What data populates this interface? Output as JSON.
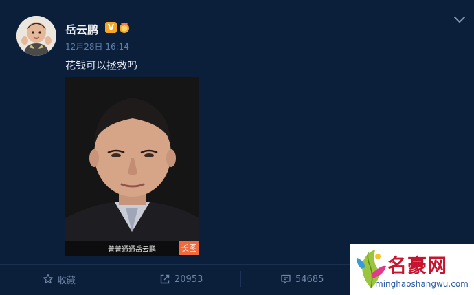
{
  "user": {
    "name": "岳云鹏",
    "verified_badge": "V"
  },
  "post": {
    "timestamp": "12月28日 16:14",
    "text": "花钱可以拯救吗",
    "image": {
      "caption": "普普通通岳云鹏",
      "long_image_badge": "长图"
    }
  },
  "actions": {
    "favorite_label": "收藏",
    "repost_count": "20953",
    "comment_count": "54685"
  },
  "watermark": {
    "title": "名豪网",
    "url": "minghaoshangwu.com"
  },
  "colors": {
    "background": "#0b1e3a",
    "verified_badge": "#f5a623",
    "long_image_badge": "#f26a3b",
    "timestamp": "#5f7ea8"
  },
  "icons": {
    "chevron": "chevron-down-icon",
    "favorite": "star-icon",
    "repost": "repost-icon",
    "comment": "comment-icon",
    "medal": "medal-icon"
  }
}
